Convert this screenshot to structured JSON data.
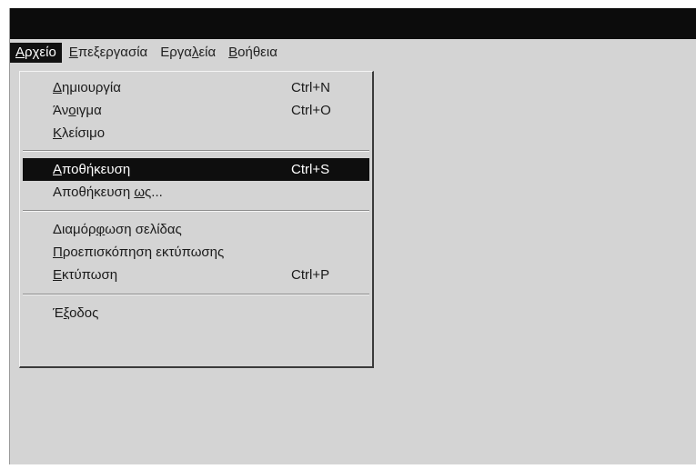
{
  "menubar": {
    "items": [
      {
        "pre": "",
        "ul": "Α",
        "post": "ρχείο"
      },
      {
        "pre": "",
        "ul": "Ε",
        "post": "πεξεργασία"
      },
      {
        "pre": "Εργα",
        "ul": "λ",
        "post": "εία"
      },
      {
        "pre": "",
        "ul": "Β",
        "post": "οήθεια"
      }
    ]
  },
  "file_menu": {
    "items": [
      {
        "pre": "",
        "ul": "Δ",
        "post": "ημιουργία",
        "shortcut": "Ctrl+N"
      },
      {
        "pre": "Άν",
        "ul": "ο",
        "post": "ιγμα",
        "shortcut": "Ctrl+O"
      },
      {
        "pre": "",
        "ul": "Κ",
        "post": "λείσιμο",
        "shortcut": ""
      },
      {
        "pre": "",
        "ul": "Α",
        "post": "ποθήκευση",
        "shortcut": "Ctrl+S"
      },
      {
        "pre": "Αποθήκευση ",
        "ul": "ω",
        "post": "ς...",
        "shortcut": ""
      },
      {
        "pre": "Διαμόρ",
        "ul": "φ",
        "post": "ωση σελίδας",
        "shortcut": ""
      },
      {
        "pre": "",
        "ul": "Π",
        "post": "ροεπισκόπηση εκτύπωσης",
        "shortcut": ""
      },
      {
        "pre": "",
        "ul": "Ε",
        "post": "κτύπωση",
        "shortcut": "Ctrl+P"
      },
      {
        "pre": "Έ",
        "ul": "ξ",
        "post": "οδος",
        "shortcut": ""
      }
    ],
    "highlighted_item": "Αποθήκευση"
  }
}
